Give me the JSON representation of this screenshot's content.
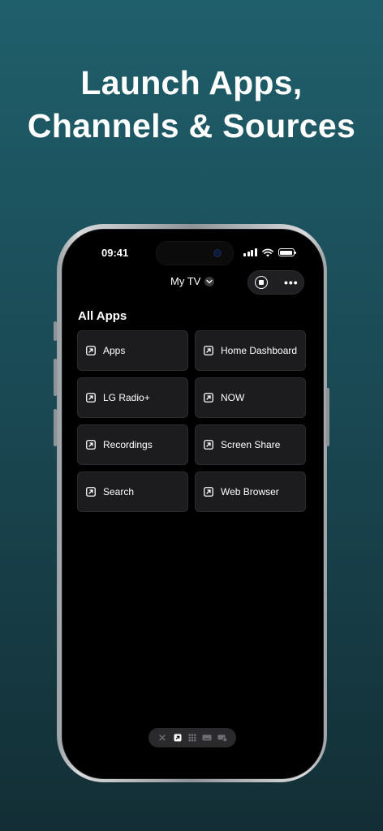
{
  "headline": {
    "line1": "Launch Apps,",
    "line2": "Channels & Sources"
  },
  "status_bar": {
    "time": "09:41"
  },
  "header": {
    "tv_name": "My TV"
  },
  "section": {
    "title": "All Apps"
  },
  "apps": [
    {
      "label": "Apps"
    },
    {
      "label": "Home Dashboard"
    },
    {
      "label": "LG Radio+"
    },
    {
      "label": "NOW"
    },
    {
      "label": "Recordings"
    },
    {
      "label": "Screen Share"
    },
    {
      "label": "Search"
    },
    {
      "label": "Web Browser"
    }
  ],
  "icons": {
    "app_tile": "arrow-up-right-square-icon",
    "tv_dropdown": "chevron-down-icon",
    "stop": "stop-circle-icon",
    "more": "more-horizontal-icon",
    "tabs": [
      "remote-icon",
      "apps-launch-icon",
      "keypad-icon",
      "keyboard-icon",
      "screen-mirror-icon"
    ]
  },
  "colors": {
    "background_top": "#1f5f6b",
    "background_bottom": "#132e35",
    "tile": "#1c1c1e"
  }
}
